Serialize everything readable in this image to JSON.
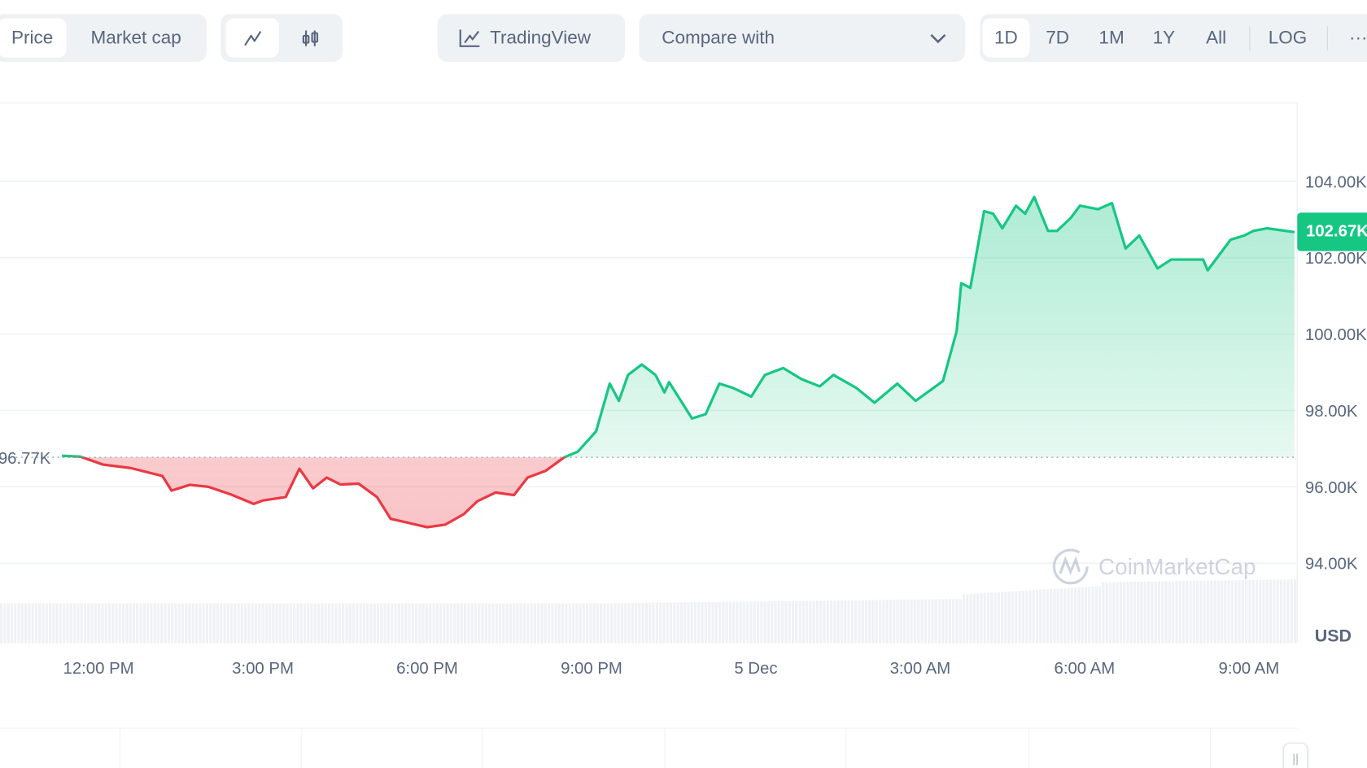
{
  "toolbar": {
    "metric_tabs": [
      "Price",
      "Market cap"
    ],
    "metric_selected": "Price",
    "chart_types": [
      "line-chart-icon",
      "candlestick-icon"
    ],
    "tradingview_label": "TradingView",
    "compare_label": "Compare with",
    "ranges": [
      "1D",
      "7D",
      "1M",
      "1Y",
      "All"
    ],
    "range_selected": "1D",
    "log_label": "LOG",
    "more_label": "···"
  },
  "colors": {
    "up": "#16c784",
    "down": "#ea3943",
    "text": "#58667e",
    "grid": "#eff2f5"
  },
  "watermark": "CoinMarketCap",
  "chart_data": {
    "type": "area",
    "title": "",
    "currency_label": "USD",
    "baseline": 96.77,
    "baseline_label": "96.77K",
    "current_price": 102.67,
    "current_price_label": "102.67K",
    "ylim": [
      92.2,
      106
    ],
    "y_ticks": [
      "104.00K",
      "102.00K",
      "100.00K",
      "98.00K",
      "96.00K",
      "94.00K"
    ],
    "y_tick_values": [
      104,
      102,
      100,
      98,
      96,
      94
    ],
    "x_ticks": [
      "12:00 PM",
      "3:00 PM",
      "6:00 PM",
      "9:00 PM",
      "5 Dec",
      "3:00 AM",
      "6:00 AM",
      "9:00 AM"
    ],
    "grid": true,
    "points": [
      [
        "4 Dec 11:20",
        96.81
      ],
      [
        "4 Dec 11:40",
        96.79
      ],
      [
        "4 Dec 12:05",
        96.58
      ],
      [
        "4 Dec 12:35",
        96.49
      ],
      [
        "4 Dec 13:10",
        96.28
      ],
      [
        "4 Dec 13:20",
        95.9
      ],
      [
        "4 Dec 13:40",
        96.05
      ],
      [
        "4 Dec 14:00",
        96.0
      ],
      [
        "4 Dec 14:25",
        95.8
      ],
      [
        "4 Dec 14:50",
        95.55
      ],
      [
        "4 Dec 15:00",
        95.64
      ],
      [
        "4 Dec 15:25",
        95.73
      ],
      [
        "4 Dec 15:40",
        96.47
      ],
      [
        "4 Dec 15:55",
        95.96
      ],
      [
        "4 Dec 16:10",
        96.24
      ],
      [
        "4 Dec 16:25",
        96.06
      ],
      [
        "4 Dec 16:45",
        96.08
      ],
      [
        "4 Dec 17:05",
        95.73
      ],
      [
        "4 Dec 17:20",
        95.16
      ],
      [
        "4 Dec 17:40",
        95.05
      ],
      [
        "4 Dec 18:00",
        94.94
      ],
      [
        "4 Dec 18:20",
        95.01
      ],
      [
        "4 Dec 18:40",
        95.28
      ],
      [
        "4 Dec 18:55",
        95.62
      ],
      [
        "4 Dec 19:15",
        95.85
      ],
      [
        "4 Dec 19:35",
        95.78
      ],
      [
        "4 Dec 19:50",
        96.24
      ],
      [
        "4 Dec 20:10",
        96.42
      ],
      [
        "4 Dec 20:30",
        96.77
      ],
      [
        "4 Dec 20:45",
        96.92
      ],
      [
        "4 Dec 21:05",
        97.45
      ],
      [
        "4 Dec 21:20",
        98.7
      ],
      [
        "4 Dec 21:30",
        98.25
      ],
      [
        "4 Dec 21:40",
        98.93
      ],
      [
        "4 Dec 21:55",
        99.2
      ],
      [
        "4 Dec 22:10",
        98.93
      ],
      [
        "4 Dec 22:20",
        98.47
      ],
      [
        "4 Dec 22:25",
        98.74
      ],
      [
        "4 Dec 22:50",
        97.79
      ],
      [
        "4 Dec 23:05",
        97.9
      ],
      [
        "4 Dec 23:20",
        98.7
      ],
      [
        "4 Dec 23:35",
        98.59
      ],
      [
        "4 Dec 23:55",
        98.36
      ],
      [
        "5 Dec 00:10",
        98.93
      ],
      [
        "5 Dec 00:30",
        99.11
      ],
      [
        "5 Dec 00:50",
        98.82
      ],
      [
        "5 Dec 01:10",
        98.63
      ],
      [
        "5 Dec 01:25",
        98.93
      ],
      [
        "5 Dec 01:50",
        98.59
      ],
      [
        "5 Dec 02:10",
        98.2
      ],
      [
        "5 Dec 02:35",
        98.7
      ],
      [
        "5 Dec 02:55",
        98.25
      ],
      [
        "5 Dec 03:25",
        98.77
      ],
      [
        "5 Dec 03:40",
        100.07
      ],
      [
        "5 Dec 03:45",
        101.33
      ],
      [
        "5 Dec 03:55",
        101.21
      ],
      [
        "5 Dec 04:10",
        103.22
      ],
      [
        "5 Dec 04:20",
        103.15
      ],
      [
        "5 Dec 04:30",
        102.77
      ],
      [
        "5 Dec 04:45",
        103.36
      ],
      [
        "5 Dec 04:55",
        103.15
      ],
      [
        "5 Dec 05:05",
        103.59
      ],
      [
        "5 Dec 05:20",
        102.7
      ],
      [
        "5 Dec 05:30",
        102.7
      ],
      [
        "5 Dec 05:45",
        103.04
      ],
      [
        "5 Dec 05:55",
        103.36
      ],
      [
        "5 Dec 06:15",
        103.27
      ],
      [
        "5 Dec 06:30",
        103.43
      ],
      [
        "5 Dec 06:45",
        102.24
      ],
      [
        "5 Dec 07:00",
        102.58
      ],
      [
        "5 Dec 07:20",
        101.72
      ],
      [
        "5 Dec 07:35",
        101.95
      ],
      [
        "5 Dec 08:10",
        101.95
      ],
      [
        "5 Dec 08:15",
        101.67
      ],
      [
        "5 Dec 08:40",
        102.47
      ],
      [
        "5 Dec 08:55",
        102.58
      ],
      [
        "5 Dec 09:05",
        102.7
      ],
      [
        "5 Dec 09:20",
        102.77
      ],
      [
        "5 Dec 09:50",
        102.67
      ]
    ]
  }
}
